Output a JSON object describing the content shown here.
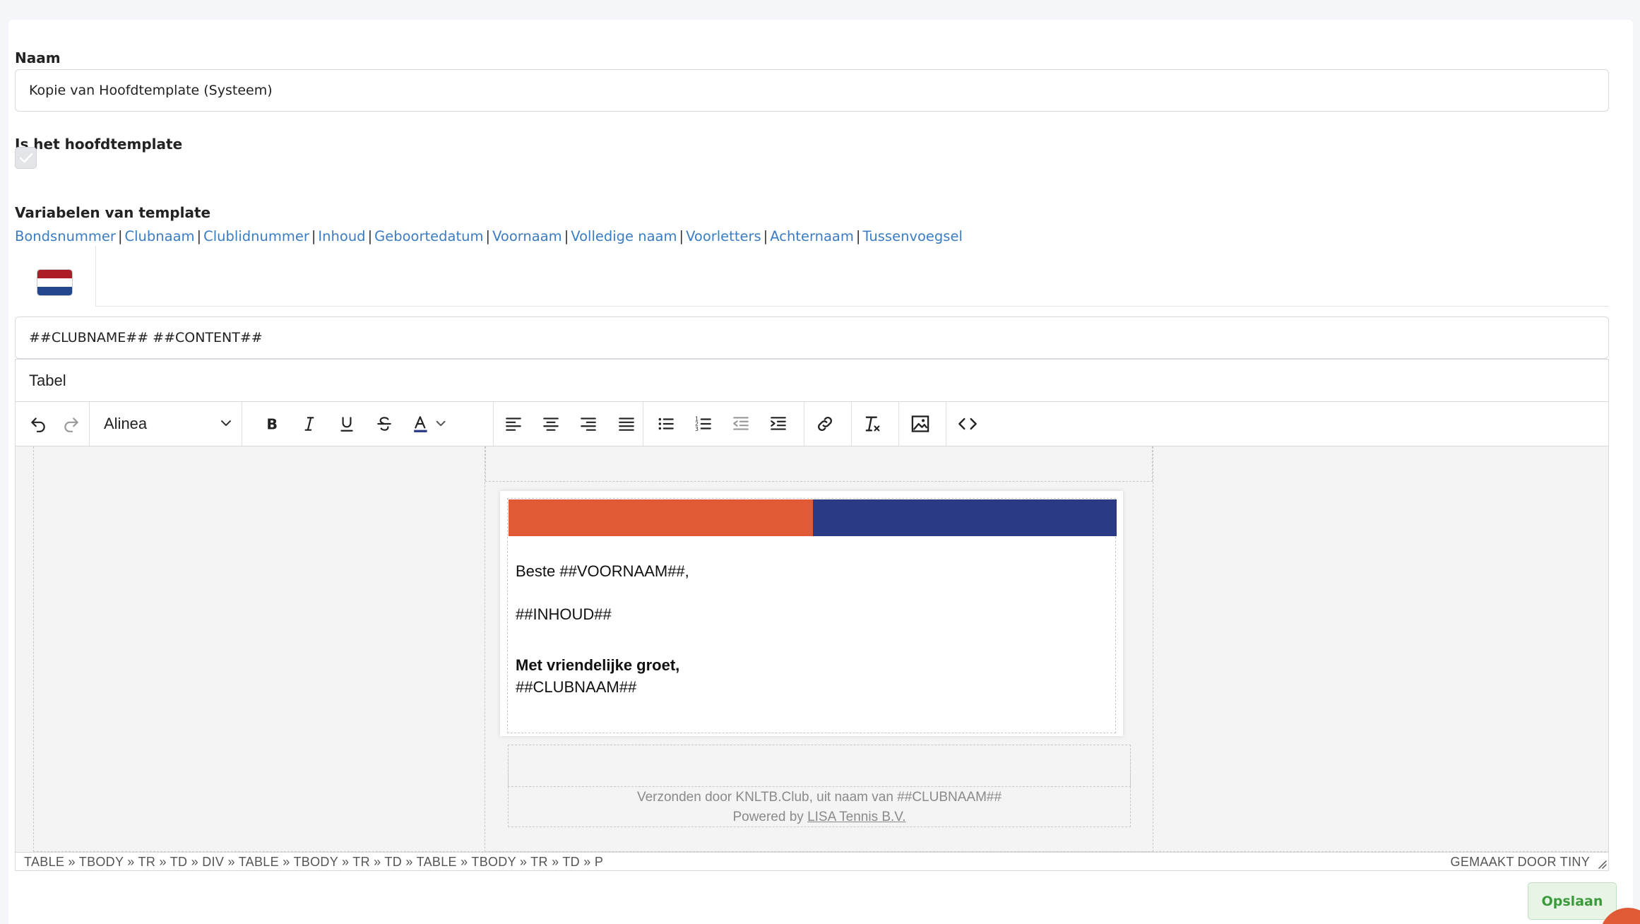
{
  "form": {
    "name_label": "Naam",
    "name_value": "Kopie van Hoofdtemplate (Systeem)",
    "main_template_label": "Is het hoofdtemplate",
    "variables_label": "Variabelen van template",
    "variables": [
      "Bondsnummer",
      "Clubnaam",
      "Clublidnummer",
      "Inhoud",
      "Geboortedatum",
      "Voornaam",
      "Volledige naam",
      "Voorletters",
      "Achternaam",
      "Tussenvoegsel"
    ],
    "subject_value": "##CLUBNAME## ##CONTENT##",
    "menubar_item": "Tabel"
  },
  "flag": {
    "red": "#ae1c28",
    "white": "#ffffff",
    "blue": "#21468b"
  },
  "toolbar": {
    "block_format": "Alinea",
    "icons": [
      "undo-icon",
      "redo-icon",
      "bold-icon",
      "italic-icon",
      "underline-icon",
      "strikethrough-icon",
      "text-color-icon",
      "align-left-icon",
      "align-center-icon",
      "align-right-icon",
      "align-justify-icon",
      "bullet-list-icon",
      "numbered-list-icon",
      "outdent-icon",
      "indent-icon",
      "link-icon",
      "clear-format-icon",
      "image-icon",
      "source-code-icon"
    ]
  },
  "email": {
    "greeting": "Beste ##VOORNAAM##,",
    "content": "##INHOUD##",
    "closing": "Met vriendelijke groet,",
    "signature": "##CLUBNAAM##",
    "footer_line1": "Verzonden door KNLTB.Club, uit naam van ##CLUBNAAM##",
    "footer_powered": "Powered by",
    "footer_link": "LISA Tennis B.V.",
    "colors": {
      "orange": "#e05a36",
      "blue": "#2a3a85"
    }
  },
  "statusbar": {
    "path": "TABLE » TBODY » TR » TD » DIV » TABLE » TBODY » TR » TD » TABLE » TBODY » TR » TD » P",
    "brand": "GEMAAKT DOOR TINY"
  },
  "actions": {
    "save_label": "Opslaan"
  }
}
